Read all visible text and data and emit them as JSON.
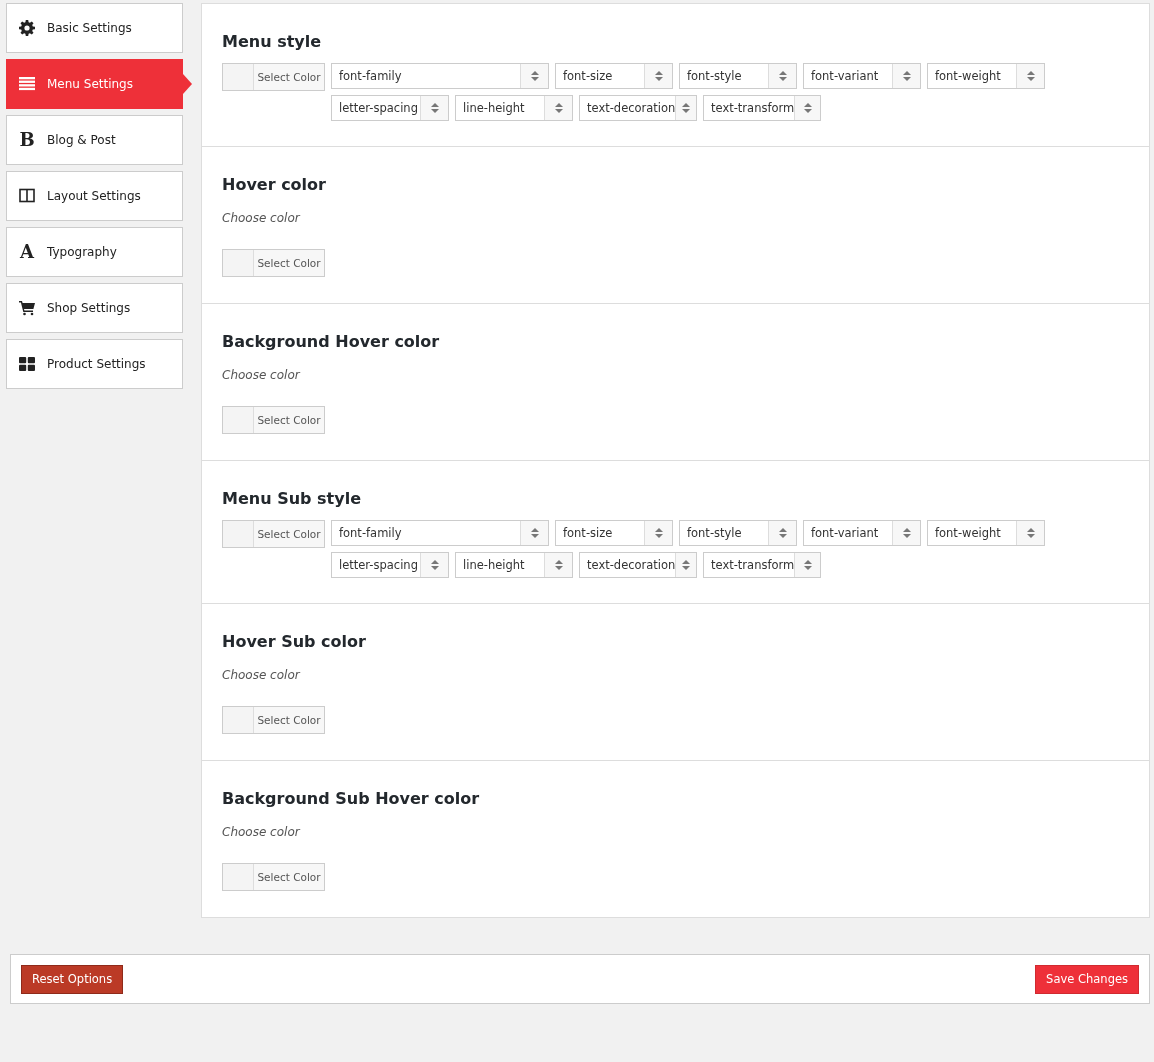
{
  "sidebar": {
    "items": [
      {
        "label": "Basic Settings",
        "kind": "gear",
        "selected": false
      },
      {
        "label": "Menu Settings",
        "kind": "list",
        "selected": true
      },
      {
        "label": "Blog & Post",
        "kind": "glyph",
        "glyph": "B",
        "selected": false
      },
      {
        "label": "Layout Settings",
        "kind": "columns",
        "selected": false
      },
      {
        "label": "Typography",
        "kind": "glyph",
        "glyph": "A",
        "selected": false
      },
      {
        "label": "Shop Settings",
        "kind": "cart",
        "selected": false
      },
      {
        "label": "Product Settings",
        "kind": "grid",
        "selected": false
      }
    ]
  },
  "sections": [
    {
      "kind": "typography",
      "title": "Menu style",
      "color_button": "Select Color",
      "selects": [
        {
          "label": "font-family"
        },
        {
          "label": "font-size"
        },
        {
          "label": "font-style"
        },
        {
          "label": "font-variant"
        },
        {
          "label": "font-weight"
        },
        {
          "label": "letter-spacing"
        },
        {
          "label": "line-height"
        },
        {
          "label": "text-decoration"
        },
        {
          "label": "text-transform"
        }
      ]
    },
    {
      "kind": "color",
      "title": "Hover color",
      "description": "Choose color",
      "color_button": "Select Color"
    },
    {
      "kind": "color",
      "title": "Background Hover color",
      "description": "Choose color",
      "color_button": "Select Color"
    },
    {
      "kind": "typography",
      "title": "Menu Sub style",
      "color_button": "Select Color",
      "selects": [
        {
          "label": "font-family"
        },
        {
          "label": "font-size"
        },
        {
          "label": "font-style"
        },
        {
          "label": "font-variant"
        },
        {
          "label": "font-weight"
        },
        {
          "label": "letter-spacing"
        },
        {
          "label": "line-height"
        },
        {
          "label": "text-decoration"
        },
        {
          "label": "text-transform"
        }
      ]
    },
    {
      "kind": "color",
      "title": "Hover Sub color",
      "description": "Choose color",
      "color_button": "Select Color"
    },
    {
      "kind": "color",
      "title": "Background Sub Hover color",
      "description": "Choose color",
      "color_button": "Select Color"
    }
  ],
  "footer": {
    "reset_button": "Reset Options",
    "save_button": "Save Changes"
  }
}
